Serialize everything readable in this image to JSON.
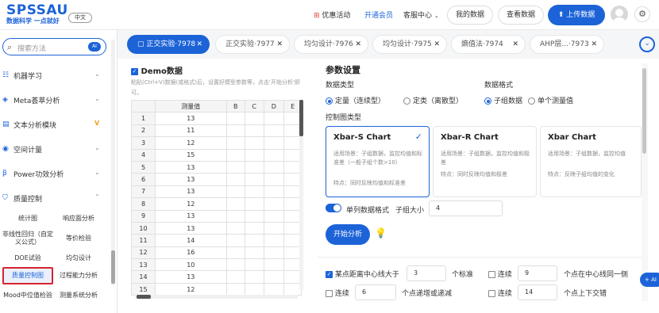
{
  "header": {
    "logo": "SPSSAU",
    "slogan": "数据科学 一点就好",
    "lang": "中文",
    "nav_promo": "优惠活动",
    "nav_member": "开通会员",
    "nav_service": "客服中心",
    "my_data": "我的数据",
    "view_data": "查看数据",
    "upload": "上传数据",
    "accent": "#1c63d8"
  },
  "sidebar": {
    "search_placeholder": "搜索方法",
    "ai_badge": "AI",
    "sections": [
      {
        "label": "机器学习",
        "icon": "ml-icon"
      },
      {
        "label": "Meta荟萃分析",
        "icon": "meta-icon"
      },
      {
        "label": "文本分析模块",
        "icon": "text-icon"
      },
      {
        "label": "空间计量",
        "icon": "spatial-icon"
      },
      {
        "label": "Power功效分析",
        "icon": "power-icon"
      },
      {
        "label": "质量控制",
        "icon": "quality-icon"
      }
    ],
    "sub_items": [
      "统计图",
      "响应面分析",
      "非线性回归（自定义公式）",
      "等价检验",
      "DOE试验",
      "均匀设计",
      "质量控制图",
      "过程能力分析",
      "Mood中位值检验",
      "测量系统分析"
    ]
  },
  "tabs": [
    {
      "label": "正交实验·7978"
    },
    {
      "label": "正交实验·7977"
    },
    {
      "label": "均匀设计·7976"
    },
    {
      "label": "均匀设计·7975"
    },
    {
      "label": "熵值法·7974"
    },
    {
      "label": "AHP层...·7973"
    }
  ],
  "left_panel": {
    "demo_label": "Demo数据",
    "hint": "粘贴(Ctrl+V)数据(或格式)后，设置好模型参数等，点击'开始分析'即可。",
    "columns": [
      "",
      "测量值",
      "B",
      "C",
      "D",
      "E"
    ],
    "rows": [
      [
        "1",
        "13"
      ],
      [
        "2",
        "11"
      ],
      [
        "3",
        "12"
      ],
      [
        "4",
        "15"
      ],
      [
        "5",
        "13"
      ],
      [
        "6",
        "13"
      ],
      [
        "7",
        "13"
      ],
      [
        "8",
        "12"
      ],
      [
        "9",
        "13"
      ],
      [
        "10",
        "13"
      ],
      [
        "11",
        "14"
      ],
      [
        "12",
        "16"
      ],
      [
        "13",
        "10"
      ],
      [
        "14",
        "13"
      ],
      [
        "15",
        "12"
      ]
    ]
  },
  "params": {
    "title": "参数设置",
    "data_type_label": "数据类型",
    "quant": "定量（连续型）",
    "qual": "定类（离散型）",
    "format_label": "数据格式",
    "subgroup": "子组数据",
    "single": "单个测量值",
    "chart_type_label": "控制图类型",
    "cards": [
      {
        "title": "Xbar-S Chart",
        "l1": "适用场景：子组数据，监控均值和标准差（一般子组个数>10）",
        "l2": "特点：同时反映均值和标准差"
      },
      {
        "title": "Xbar-R Chart",
        "l1": "适用场景：子组数据，监控均值和极差",
        "l2": "特点：同时反映均值和极差"
      },
      {
        "title": "Xbar Chart",
        "l1": "适用场景：子组数据，监控均值",
        "l2": "特点：反映子组均值的变化"
      }
    ],
    "single_col": "单列数据格式",
    "subgroup_size_label": "子组大小",
    "subgroup_size": "4",
    "start": "开始分析",
    "rules": [
      {
        "pre": "某点距离中心线大于",
        "val": "3",
        "post": "个标准"
      },
      {
        "pre": "连续",
        "val": "9",
        "post": "个点在中心线同一侧"
      },
      {
        "pre": "连续",
        "val": "6",
        "post": "个点递增或递减"
      },
      {
        "pre": "连续",
        "val": "14",
        "post": "个点上下交错"
      }
    ],
    "ai_float": "AI"
  }
}
